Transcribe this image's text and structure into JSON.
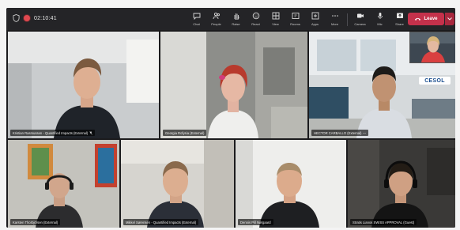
{
  "call": {
    "timer": "02:10:41",
    "recording_color": "#e0484f"
  },
  "toolbar": {
    "items": [
      {
        "label": "Chat",
        "icon": "chat-icon"
      },
      {
        "label": "People",
        "icon": "people-icon"
      },
      {
        "label": "Raise",
        "icon": "raise-hand-icon"
      },
      {
        "label": "React",
        "icon": "react-icon"
      },
      {
        "label": "View",
        "icon": "view-icon"
      },
      {
        "label": "Rooms",
        "icon": "rooms-icon"
      },
      {
        "label": "Apps",
        "icon": "apps-icon"
      },
      {
        "label": "More",
        "icon": "more-icon"
      }
    ],
    "av_items": [
      {
        "label": "Camera",
        "icon": "camera-icon"
      },
      {
        "label": "Mic",
        "icon": "mic-icon"
      },
      {
        "label": "Share",
        "icon": "share-icon"
      }
    ],
    "leave_label": "Leave",
    "leave_color": "#c4314b"
  },
  "participants": [
    {
      "name": "Kristian Rasmussen - Quantified Impacts (External)",
      "muted": true
    },
    {
      "name": "Georgia Rofysia (External)",
      "muted": false
    },
    {
      "name": "HECTOR CARBALLO (External)",
      "muted": false
    },
    {
      "name": "Karsten Thorbjörsen (External)",
      "muted": true
    },
    {
      "name": "Mikkel Sørensen - Quantified Impacts (External)",
      "muted": false
    },
    {
      "name": "Dennis Pill Nørgaard",
      "muted": false
    },
    {
      "name": "Stratis Lianos SWISS APPROVAL (Guest)",
      "muted": false
    }
  ],
  "self_view": {
    "logo_text": "CESOL"
  }
}
